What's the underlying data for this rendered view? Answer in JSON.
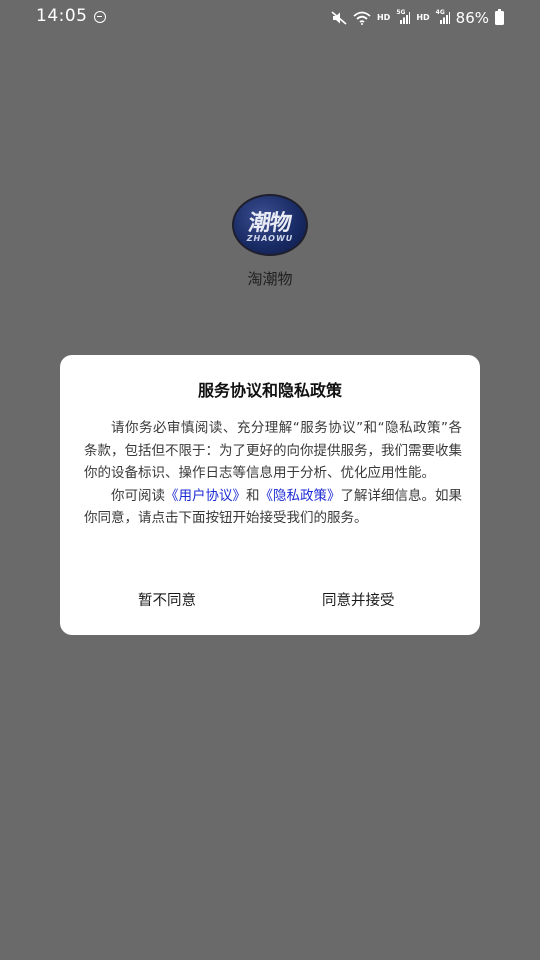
{
  "status_bar": {
    "time": "14:05",
    "hd1": "HD",
    "net1": "5G",
    "hd2": "HD",
    "net2": "4G",
    "battery": "86%"
  },
  "app": {
    "logo_main": "潮物",
    "logo_sub": "ZHAOWU",
    "name": "淘潮物"
  },
  "dialog": {
    "title": "服务协议和隐私政策",
    "para1": "请你务必审慎阅读、充分理解“服务协议”和“隐私政策”各条款，包括但不限于：为了更好的向你提供服务，我们需要收集你的设备标识、操作日志等信息用于分析、优化应用性能。",
    "para2_prefix": "你可阅读",
    "user_agreement_link": "《用户协议》",
    "para2_and": "和",
    "privacy_policy_link": "《隐私政策》",
    "para2_suffix": "了解详细信息。如果你同意，请点击下面按钮开始接受我们的服务。",
    "decline_label": "暂不同意",
    "accept_label": "同意并接受"
  }
}
